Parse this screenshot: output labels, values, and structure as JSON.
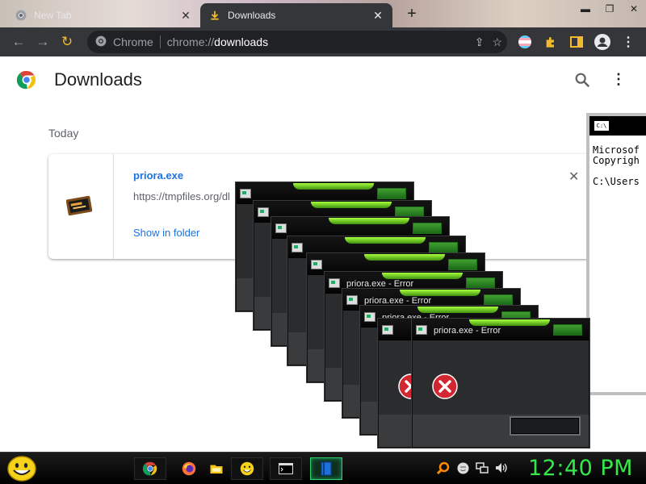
{
  "browser": {
    "tabs": [
      {
        "label": "New Tab",
        "active": false
      },
      {
        "label": "Downloads",
        "active": true
      }
    ],
    "new_tab_symbol": "+",
    "omnibox": {
      "scheme_label": "Chrome",
      "url_prefix": "chrome://",
      "url_host": "downloads"
    }
  },
  "downloads": {
    "title": "Downloads",
    "section_label": "Today",
    "items": [
      {
        "filename": "priora.exe",
        "url": "https://tmpfiles.org/dl",
        "action_label": "Show in folder"
      }
    ]
  },
  "console": {
    "lines": [
      "Microsof",
      "Copyrigh",
      "",
      "C:\\Users"
    ]
  },
  "error_windows": [
    {
      "title": ""
    },
    {
      "title": ""
    },
    {
      "title": ""
    },
    {
      "title": ""
    },
    {
      "title": ""
    },
    {
      "title": "priora.exe - Error"
    },
    {
      "title": "priora.exe - Error"
    },
    {
      "title": "priora.exe - Error"
    },
    {
      "title": ""
    },
    {
      "title": "priora.exe - Error"
    }
  ],
  "taskbar": {
    "clock": "12:40 PM",
    "items": [
      "chrome-icon",
      "firefox-icon",
      "folder-icon",
      "smiley-icon",
      "console-icon",
      "book-icon"
    ]
  },
  "colors": {
    "chrome_dark": "#35363a",
    "link_blue": "#1a73e8",
    "clock_green": "#34e84b",
    "error_red": "#d22630"
  }
}
